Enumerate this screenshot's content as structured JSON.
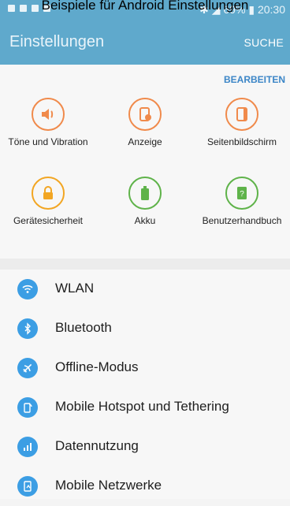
{
  "caption": "Beispiele für Android Einstellungen",
  "status": {
    "battery": "69%",
    "time": "20:30"
  },
  "header": {
    "title": "Einstellungen",
    "search_label": "SUCHE"
  },
  "quick_settings": {
    "edit_label": "BEARBEITEN",
    "tiles": [
      {
        "label": "Töne und Vibration",
        "icon": "speaker-icon",
        "color": "#f08a4b"
      },
      {
        "label": "Anzeige",
        "icon": "display-settings-icon",
        "color": "#f08a4b"
      },
      {
        "label": "Seitenbildschirm",
        "icon": "edge-screen-icon",
        "color": "#f08a4b"
      },
      {
        "label": "Gerätesicherheit",
        "icon": "lock-icon",
        "color": "#f2a623"
      },
      {
        "label": "Akku",
        "icon": "battery-icon",
        "color": "#5fb34a"
      },
      {
        "label": "Benutzerhandbuch",
        "icon": "help-book-icon",
        "color": "#5fb34a"
      }
    ]
  },
  "settings_list": [
    {
      "label": "WLAN",
      "icon": "wifi-icon"
    },
    {
      "label": "Bluetooth",
      "icon": "bluetooth-icon"
    },
    {
      "label": "Offline-Modus",
      "icon": "airplane-icon"
    },
    {
      "label": "Mobile Hotspot und Tethering",
      "icon": "hotspot-icon"
    },
    {
      "label": "Datennutzung",
      "icon": "data-usage-icon"
    },
    {
      "label": "Mobile Netzwerke",
      "icon": "mobile-networks-icon"
    }
  ],
  "colors": {
    "header": "#5fa9cc",
    "accent": "#3c86c7",
    "list_icon": "#3c9ee4"
  }
}
